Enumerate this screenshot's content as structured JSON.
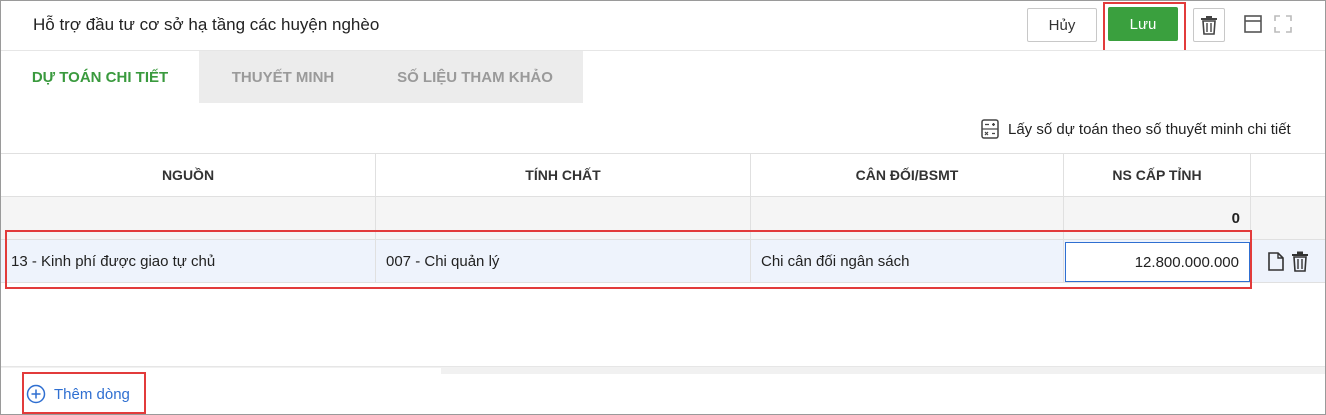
{
  "header": {
    "title": "Hỗ trợ đầu tư cơ sở hạ tầng các huyện nghèo",
    "cancel_label": "Hủy",
    "save_label": "Lưu"
  },
  "tabs": [
    {
      "label": "DỰ TOÁN CHI TIẾT",
      "active": true
    },
    {
      "label": "THUYẾT MINH",
      "active": false
    },
    {
      "label": "SỐ LIỆU THAM KHẢO",
      "active": false
    }
  ],
  "link_bar": {
    "label": "Lấy số dự toán theo số thuyết minh chi tiết"
  },
  "table": {
    "columns": [
      "NGUỒN",
      "TÍNH CHẤT",
      "CÂN ĐỐI/BSMT",
      "NS CẤP TỈNH"
    ],
    "summary": {
      "ns_cap_tinh": "0"
    },
    "rows": [
      {
        "nguon": "13 - Kinh phí được giao tự chủ",
        "tinh_chat": "007 - Chi quản lý",
        "can_doi": "Chi cân đối ngân sách",
        "ns_cap_tinh": "12.800.000.000"
      }
    ]
  },
  "footer": {
    "add_row_label": "Thêm dòng"
  },
  "colors": {
    "accent_green": "#3aa03e",
    "link_blue": "#2f6fd1",
    "highlight_red": "#e23b3b"
  }
}
